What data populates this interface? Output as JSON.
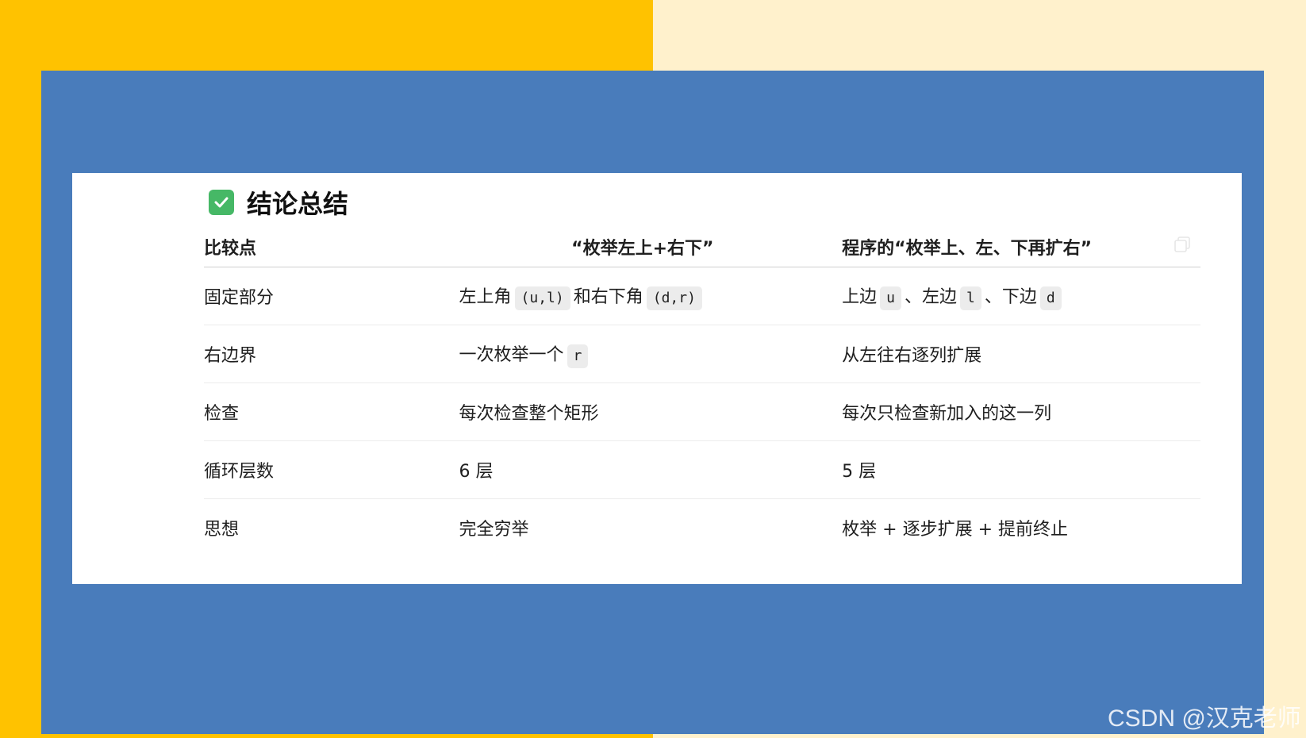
{
  "colors": {
    "bg_left": "#ffc200",
    "bg_right": "#fff1cc",
    "panel": "#497cbb",
    "card": "#ffffff",
    "check": "#46b866"
  },
  "heading": {
    "icon": "check-box-icon",
    "title": "结论总结"
  },
  "copy_icon": "copy-icon",
  "table": {
    "headers": [
      "比较点",
      "“枚举左上+右下”",
      "程序的“枚举上、左、下再扩右”"
    ],
    "rows": [
      {
        "label": "固定部分",
        "a": [
          "左上角",
          "(u,l)",
          "和右下角",
          "(d,r)"
        ],
        "b": [
          "上边",
          "u",
          "、左边",
          "l",
          "、下边",
          "d"
        ]
      },
      {
        "label": "右边界",
        "a": [
          "一次枚举一个",
          "r"
        ],
        "b": "从左往右逐列扩展"
      },
      {
        "label": "检查",
        "a": "每次检查整个矩形",
        "b": "每次只检查新加入的这一列"
      },
      {
        "label": "循环层数",
        "a": "6 层",
        "b": "5 层"
      },
      {
        "label": "思想",
        "a": "完全穷举",
        "b": "枚举 + 逐步扩展 + 提前终止"
      }
    ]
  },
  "watermark": "CSDN @汉克老师"
}
